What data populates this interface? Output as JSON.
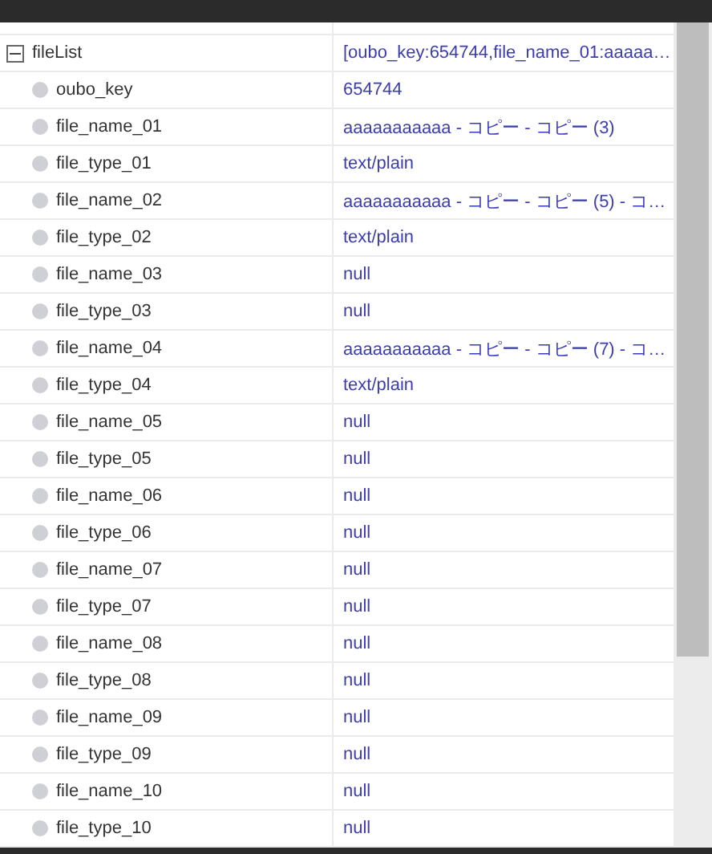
{
  "tree": {
    "label": "fileList",
    "value": "[oubo_key:654744,file_name_01:aaaaa…",
    "expanded": true,
    "children": [
      {
        "label": "oubo_key",
        "value": "654744"
      },
      {
        "label": "file_name_01",
        "value": "aaaaaaaaaaa - コピー - コピー (3)"
      },
      {
        "label": "file_type_01",
        "value": "text/plain"
      },
      {
        "label": "file_name_02",
        "value": "aaaaaaaaaaa - コピー - コピー (5) - コ…"
      },
      {
        "label": "file_type_02",
        "value": "text/plain"
      },
      {
        "label": "file_name_03",
        "value": "null"
      },
      {
        "label": "file_type_03",
        "value": "null"
      },
      {
        "label": "file_name_04",
        "value": "aaaaaaaaaaa - コピー - コピー (7) - コ…"
      },
      {
        "label": "file_type_04",
        "value": "text/plain"
      },
      {
        "label": "file_name_05",
        "value": "null"
      },
      {
        "label": "file_type_05",
        "value": "null"
      },
      {
        "label": "file_name_06",
        "value": "null"
      },
      {
        "label": "file_type_06",
        "value": "null"
      },
      {
        "label": "file_name_07",
        "value": "null"
      },
      {
        "label": "file_type_07",
        "value": "null"
      },
      {
        "label": "file_name_08",
        "value": "null"
      },
      {
        "label": "file_type_08",
        "value": "null"
      },
      {
        "label": "file_name_09",
        "value": "null"
      },
      {
        "label": "file_type_09",
        "value": "null"
      },
      {
        "label": "file_name_10",
        "value": "null"
      },
      {
        "label": "file_type_10",
        "value": "null"
      }
    ]
  }
}
